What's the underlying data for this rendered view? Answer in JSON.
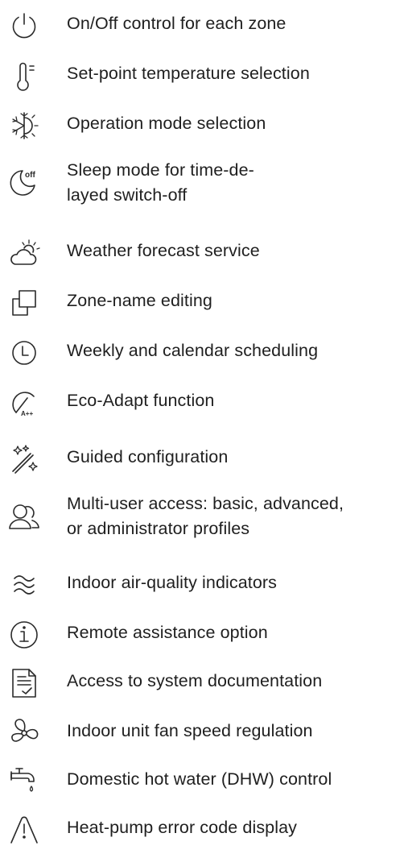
{
  "features": [
    {
      "icon": "power-icon",
      "label": "On/Off control for each zone"
    },
    {
      "icon": "thermometer-icon",
      "label": "Set-point temperature selection"
    },
    {
      "icon": "sun-snowflake-icon",
      "label": "Operation mode selection"
    },
    {
      "icon": "moon-off-icon",
      "icon_text": "off",
      "label_lines": [
        "Sleep mode for time-de-",
        "layed switch-off"
      ]
    },
    {
      "icon": "cloud-sun-icon",
      "label": "Weather forecast service"
    },
    {
      "icon": "copy-squares-icon",
      "label": "Zone-name editing"
    },
    {
      "icon": "clock-icon",
      "label": "Weekly and calendar scheduling"
    },
    {
      "icon": "eco-gauge-icon",
      "icon_text": "A++",
      "label": "Eco-Adapt function"
    },
    {
      "icon": "magic-wand-icon",
      "label": "Guided configuration"
    },
    {
      "icon": "users-icon",
      "label_lines": [
        "Multi-user access: basic, advanced,",
        "or administrator profiles"
      ]
    },
    {
      "icon": "air-waves-icon",
      "label": "Indoor air-quality indicators"
    },
    {
      "icon": "info-circle-icon",
      "label": "Remote assistance option"
    },
    {
      "icon": "document-check-icon",
      "label": "Access to system documentation"
    },
    {
      "icon": "fan-icon",
      "label": "Indoor unit fan speed regulation"
    },
    {
      "icon": "faucet-icon",
      "label": "Domestic hot water (DHW) control"
    },
    {
      "icon": "warning-triangle-icon",
      "label": "Heat-pump error code display"
    }
  ]
}
